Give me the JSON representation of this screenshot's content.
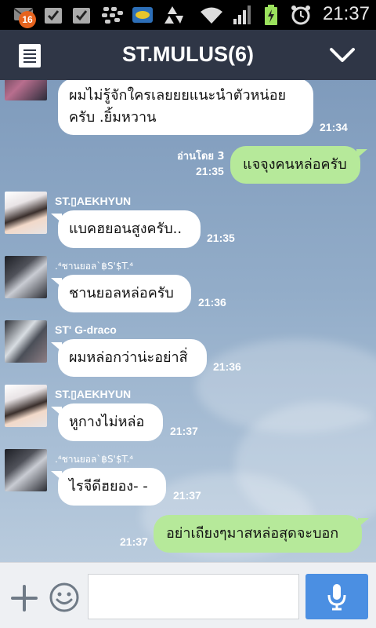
{
  "status_bar": {
    "time": "21:37",
    "notification_count": "16",
    "icons": [
      "mail-icon",
      "checkbox-icon",
      "checkbox-icon",
      "bbm-icon",
      "ticket-icon",
      "recycle-icon",
      "wifi-icon",
      "signal-icon",
      "battery-charging-icon",
      "alarm-icon"
    ]
  },
  "header": {
    "title": "ST.MULUS(6)",
    "menu_icon": "menu-icon",
    "collapse_icon": "chevron-down-icon",
    "background": "#2f3646"
  },
  "messages": [
    {
      "side": "in",
      "sender": "",
      "lines": [
        "ผมไม่รู้จักใครเลยยยแนะนำตัวหน่อย",
        "ครับ .ยิ้มหวาน"
      ],
      "time": "21:34"
    },
    {
      "side": "out",
      "read": "อ่านโดย 3",
      "text": "แจจุงคนหล่อครับ",
      "time": "21:35"
    },
    {
      "side": "in",
      "sender": "ST.▯AEKHYUN",
      "lines": [
        "แบคฮยอนสูงครับ.."
      ],
      "time": "21:35"
    },
    {
      "side": "in",
      "sender": ".⁴ชานยอล`฿S'$T.⁴",
      "lines": [
        "ชานยอลหล่อครับ"
      ],
      "time": "21:36"
    },
    {
      "side": "in",
      "sender": "ST' G-draco",
      "lines": [
        "ผมหล่อกว่าน่ะอย่าสิ่"
      ],
      "time": "21:36"
    },
    {
      "side": "in",
      "sender": "ST.▯AEKHYUN",
      "lines": [
        "หูกางไม่หล่อ"
      ],
      "time": "21:37"
    },
    {
      "side": "in",
      "sender": ".⁴ชานยอล`฿S'$T.⁴",
      "lines": [
        "ไรจีดีฮยอง- -"
      ],
      "time": "21:37"
    },
    {
      "side": "out",
      "read": "",
      "text": "อย่าเถียงๆมาสหล่อสุดจะบอก",
      "time": "21:37"
    }
  ],
  "input_bar": {
    "add_icon": "plus-icon",
    "emoji_icon": "smiley-icon",
    "mic_icon": "microphone-icon",
    "message_placeholder": "",
    "accent": "#4b8fe2"
  },
  "colors": {
    "incoming_bubble": "#ffffff",
    "outgoing_bubble": "#b6e99a"
  }
}
